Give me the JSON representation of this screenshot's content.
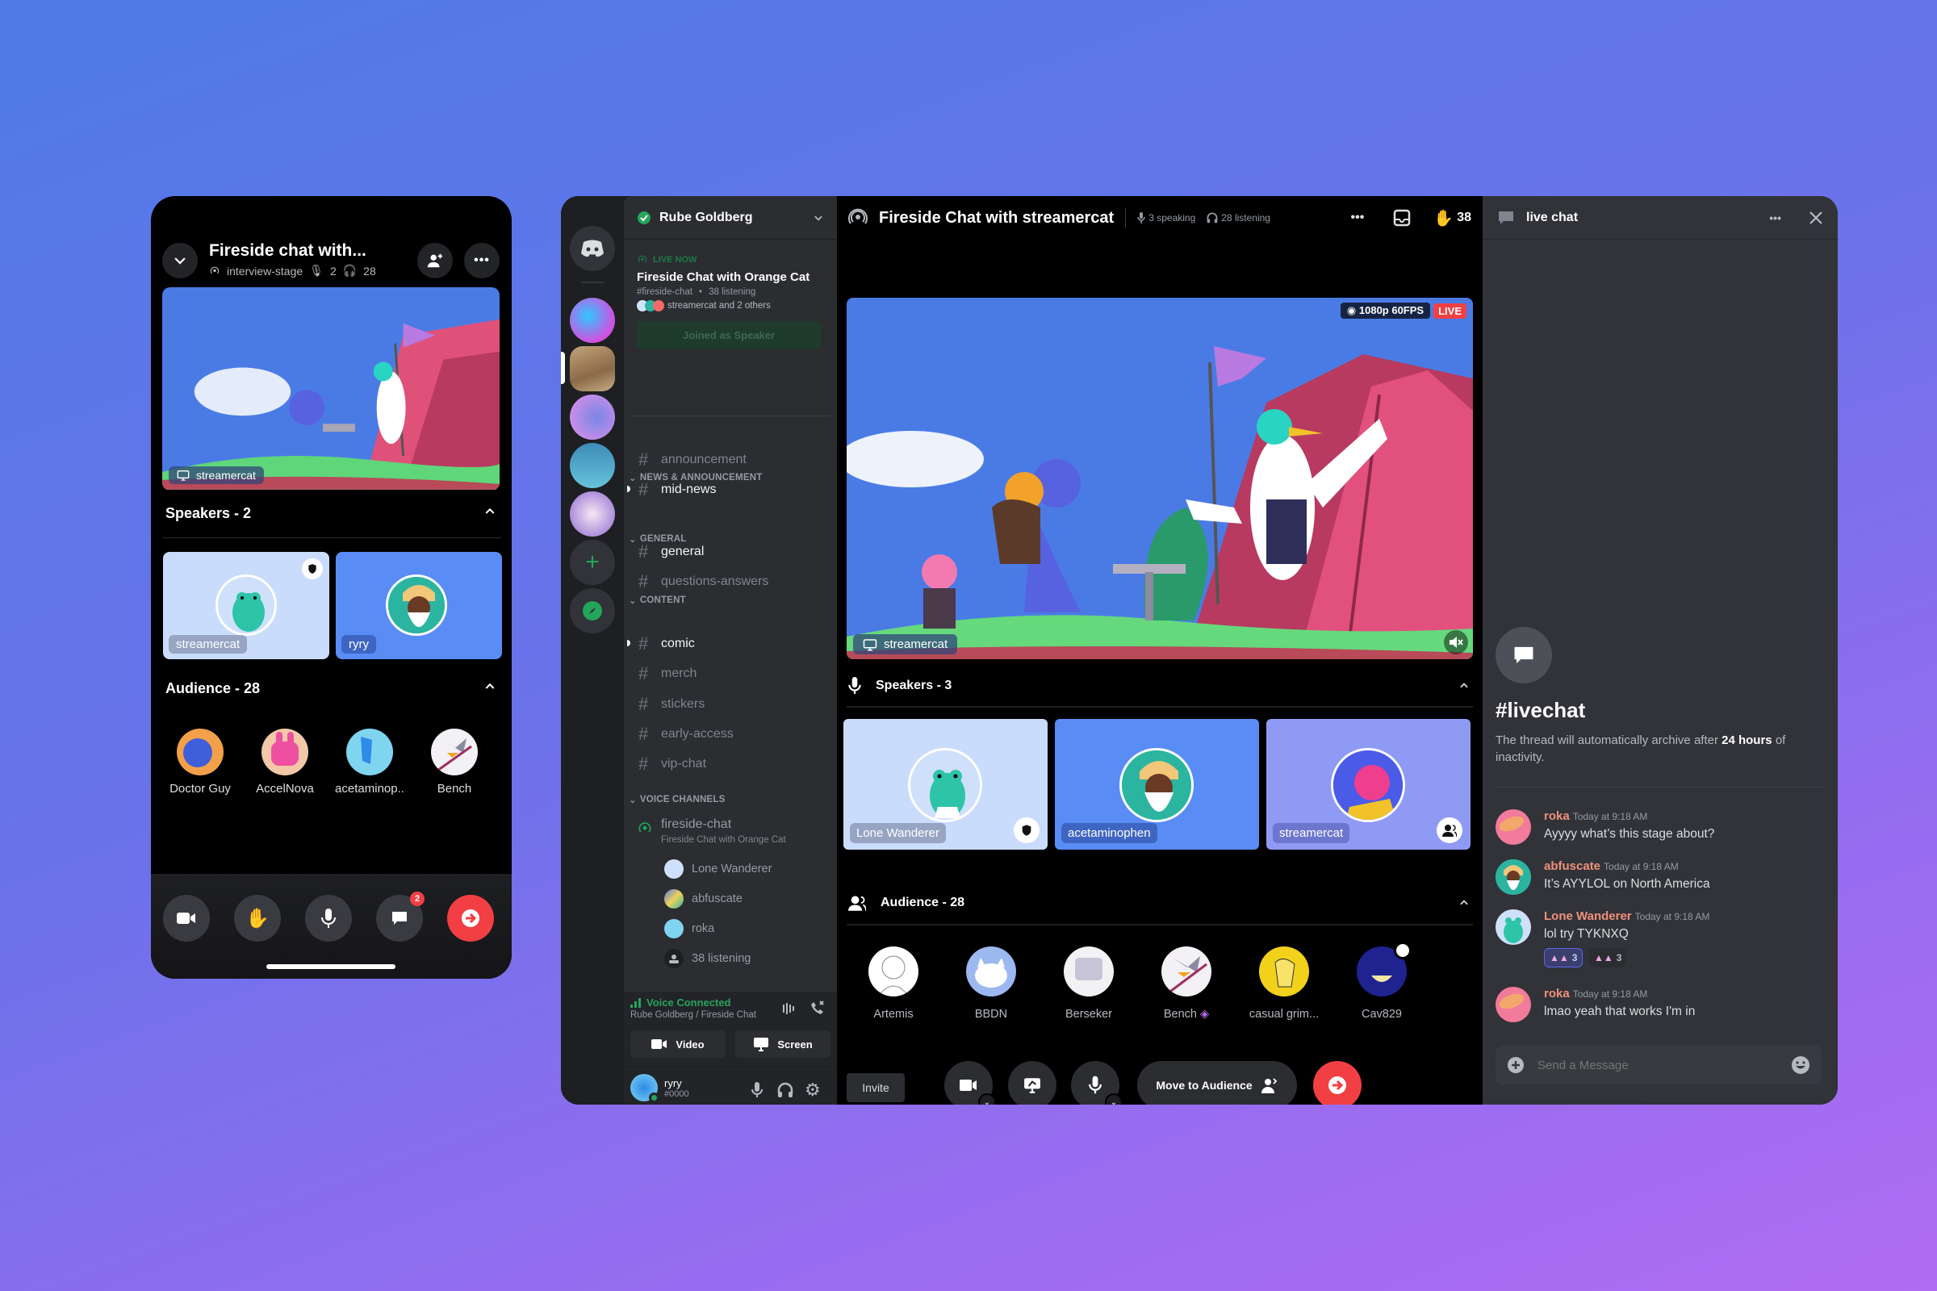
{
  "colors": {
    "brand": "#5865f2",
    "green": "#23a55a",
    "danger": "#f23f43",
    "username": "#f0917a"
  },
  "mobile": {
    "title": "Fireside chat with...",
    "stage_channel": "interview-stage",
    "speaker_count": "2",
    "listener_count": "28",
    "stream_user": "streamercat",
    "speakers_header": "Speakers - 2",
    "audience_header": "Audience - 28",
    "speakers": [
      {
        "name": "streamercat",
        "bg": "#c9dcfb",
        "moderator": true
      },
      {
        "name": "ryry",
        "bg": "#5a8cf5",
        "moderator": false
      }
    ],
    "audience": [
      {
        "name": "Doctor Guy"
      },
      {
        "name": "AccelNova"
      },
      {
        "name": "acetaminop.."
      },
      {
        "name": "Bench"
      },
      {
        "name": ""
      },
      {
        "name": ""
      },
      {
        "name": ""
      },
      {
        "name": ""
      }
    ],
    "controls": {
      "video": "video-icon",
      "hand": "raise-hand-icon",
      "mic": "mic-icon",
      "chat": "chat-icon",
      "chat_badge": "2",
      "leave": "leave-icon"
    }
  },
  "desktop": {
    "server_rail": {
      "home": "discord-home-icon",
      "servers": [
        "server-1",
        "server-2",
        "server-3",
        "server-4",
        "server-5"
      ],
      "add": "add-server-icon",
      "explore": "explore-icon"
    },
    "sidebar": {
      "server_name": "Rube Goldberg",
      "live_label": "LIVE NOW",
      "live_title": "Fireside Chat with Orange Cat",
      "live_channel": "#fireside-chat",
      "live_listening": "38 listening",
      "live_participants": "streamercat and 2 others",
      "joined_button": "Joined as Speaker",
      "categories": [
        {
          "name": "NEWS & ANNOUNCEMENT",
          "channels": [
            {
              "name": "announcement",
              "unread": false
            },
            {
              "name": "mid-news",
              "unread": true
            }
          ]
        },
        {
          "name": "GENERAL",
          "channels": [
            {
              "name": "general",
              "unread": false,
              "active": true
            },
            {
              "name": "questions-answers",
              "unread": false
            }
          ]
        },
        {
          "name": "CONTENT",
          "channels": [
            {
              "name": "comic",
              "unread": true
            },
            {
              "name": "merch",
              "unread": false
            },
            {
              "name": "stickers",
              "unread": false
            },
            {
              "name": "early-access",
              "unread": false
            },
            {
              "name": "vip-chat",
              "unread": false
            }
          ]
        }
      ],
      "voice_category": "VOICE CHANNELS",
      "voice_channel": {
        "name": "fireside-chat",
        "topic": "Fireside Chat with Orange Cat",
        "users": [
          "Lone Wanderer",
          "abfuscate",
          "roka"
        ],
        "listening": "38 listening"
      },
      "voice_status": "Voice Connected",
      "voice_location": "Rube Goldberg / Fireside Chat",
      "video_button": "Video",
      "screen_button": "Screen",
      "user": {
        "name": "ryry",
        "tag": "#0000"
      }
    },
    "stage": {
      "title": "Fireside Chat with streamercat",
      "speaking": "3 speaking",
      "listening": "28 listening",
      "hand_count": "38",
      "resolution": "1080p 60FPS",
      "live_badge": "LIVE",
      "stream_user": "streamercat",
      "speakers_header": "Speakers - 3",
      "speakers": [
        {
          "name": "Lone Wanderer",
          "bg": "#c9dcfb",
          "badge": "moderator"
        },
        {
          "name": "acetaminophen",
          "bg": "#5a8cf5",
          "badge": ""
        },
        {
          "name": "streamercat",
          "bg": "#8f9af5",
          "badge": "audience"
        }
      ],
      "audience_header": "Audience - 28",
      "audience": [
        {
          "name": "Artemis"
        },
        {
          "name": "BBDN"
        },
        {
          "name": "Berseker"
        },
        {
          "name": "Bench",
          "boost": true
        },
        {
          "name": "casual grim..."
        },
        {
          "name": "Cav829",
          "status": true
        }
      ],
      "invite_button": "Invite",
      "move_button": "Move to Audience"
    },
    "chat": {
      "title": "live chat",
      "thread_name": "#livechat",
      "archive_note_pre": "The thread will automatically archive after ",
      "archive_note_bold": "24 hours",
      "archive_note_post": " of inactivity.",
      "messages": [
        {
          "user": "roka",
          "time": "Today at 9:18 AM",
          "text": "Ayyyy what’s this stage about?"
        },
        {
          "user": "abfuscate",
          "time": "Today at 9:18 AM",
          "text": "It’s AYYLOL on North America"
        },
        {
          "user": "Lone Wanderer",
          "time": "Today at 9:18 AM",
          "text": "lol try TYKNXQ",
          "reactions": [
            {
              "count": "3",
              "mine": true
            },
            {
              "count": "3",
              "mine": false
            }
          ]
        },
        {
          "user": "roka",
          "time": "Today at 9:18 AM",
          "text": "lmao yeah that works I'm in"
        }
      ],
      "input_placeholder": "Send a Message"
    }
  }
}
